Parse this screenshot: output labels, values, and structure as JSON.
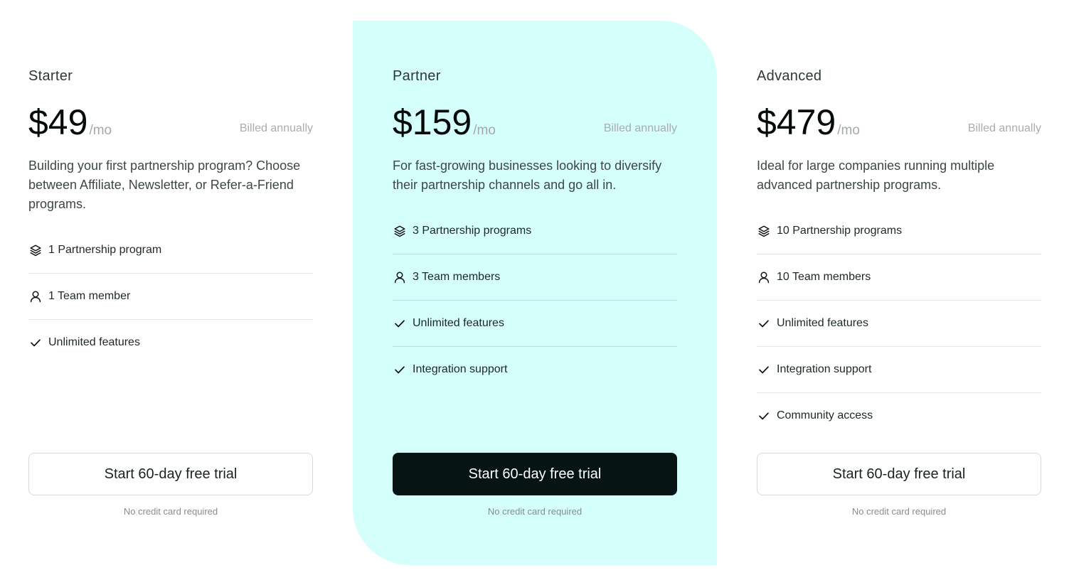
{
  "colors": {
    "highlight_background": "#d4fffb",
    "primary_button": "#061413",
    "divider": "#e3e6e6"
  },
  "plans": [
    {
      "name": "Starter",
      "price": "$49",
      "period": "/mo",
      "billing": "Billed annually",
      "description": "Building your first partnership program? Choose between Affiliate, Newsletter, or Refer-a-Friend programs.",
      "features": [
        {
          "icon": "layers-icon",
          "label": "1 Partnership program"
        },
        {
          "icon": "user-icon",
          "label": "1 Team member"
        },
        {
          "icon": "check-icon",
          "label": "Unlimited features"
        }
      ],
      "cta_label": "Start 60-day free trial",
      "note": "No credit card required",
      "highlighted": false
    },
    {
      "name": "Partner",
      "price": "$159",
      "period": "/mo",
      "billing": "Billed annually",
      "description": "For fast-growing businesses looking to diversify their partnership channels and go all in.",
      "features": [
        {
          "icon": "layers-icon",
          "label": "3 Partnership programs"
        },
        {
          "icon": "user-icon",
          "label": "3 Team members"
        },
        {
          "icon": "check-icon",
          "label": "Unlimited features"
        },
        {
          "icon": "check-icon",
          "label": "Integration support"
        }
      ],
      "cta_label": "Start 60-day free trial",
      "note": "No credit card required",
      "highlighted": true
    },
    {
      "name": "Advanced",
      "price": "$479",
      "period": "/mo",
      "billing": "Billed annually",
      "description": "Ideal for large companies running multiple advanced partnership programs.",
      "features": [
        {
          "icon": "layers-icon",
          "label": "10 Partnership programs"
        },
        {
          "icon": "user-icon",
          "label": "10 Team members"
        },
        {
          "icon": "check-icon",
          "label": "Unlimited features"
        },
        {
          "icon": "check-icon",
          "label": "Integration support"
        },
        {
          "icon": "check-icon",
          "label": "Community access"
        }
      ],
      "cta_label": "Start 60-day free trial",
      "note": "No credit card required",
      "highlighted": false
    }
  ]
}
